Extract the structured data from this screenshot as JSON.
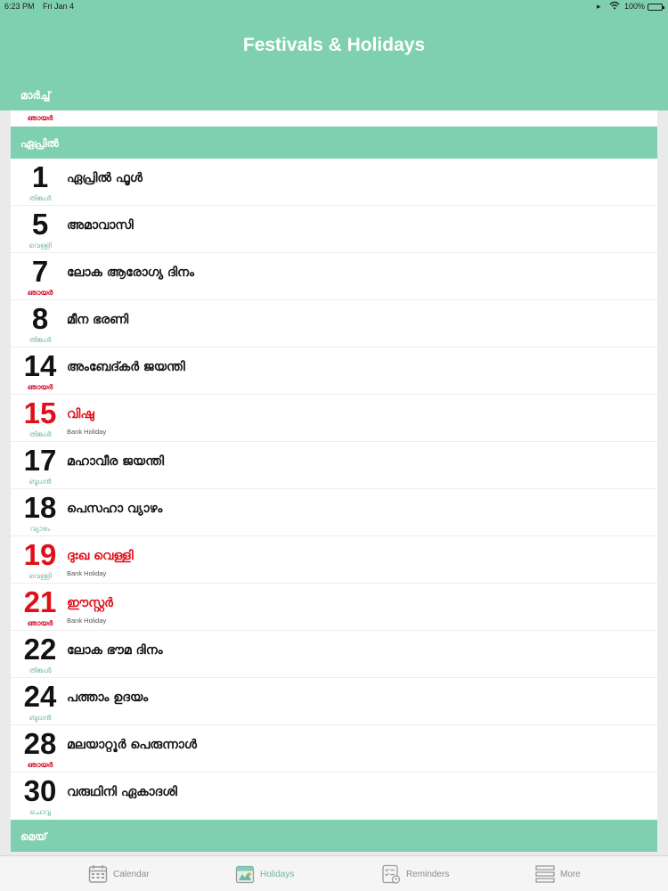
{
  "status_bar": {
    "time": "6:23 PM",
    "date": "Fri Jan 4",
    "battery": "100%"
  },
  "header": {
    "title": "Festivals & Holidays"
  },
  "colors": {
    "accent": "#7fcfb1",
    "holiday_red": "#e0101a",
    "weekday_green": "#6fb7a0"
  },
  "sticky_section": {
    "label": "മാർച്ച്",
    "trailing_weekday": "ഞായർ"
  },
  "april": {
    "label": "ഏപ്രിൽ",
    "rows": [
      {
        "day": "1",
        "weekday": "തിങ്കൾ",
        "title": "ഏപ്രിൽ ഫൂൾ",
        "sub": ""
      },
      {
        "day": "5",
        "weekday": "വെള്ളി",
        "title": "അമാവാസി",
        "sub": ""
      },
      {
        "day": "7",
        "weekday": "ഞായർ",
        "title": "ലോക ആരോഗ്യ ദിനം",
        "sub": ""
      },
      {
        "day": "8",
        "weekday": "തിങ്കൾ",
        "title": "മീന ഭരണി",
        "sub": ""
      },
      {
        "day": "14",
        "weekday": "ഞായർ",
        "title": "അംബേദ്കർ ജയന്തി",
        "sub": ""
      },
      {
        "day": "15",
        "weekday": "തിങ്കൾ",
        "title": "വിഷു",
        "sub": "Bank Holiday"
      },
      {
        "day": "17",
        "weekday": "ബുധൻ",
        "title": "മഹാവീര ജയന്തി",
        "sub": ""
      },
      {
        "day": "18",
        "weekday": "വ്യാഴം",
        "title": "പെസഹാ വ്യാഴം",
        "sub": ""
      },
      {
        "day": "19",
        "weekday": "വെള്ളി",
        "title": "ദുഃഖ വെള്ളി",
        "sub": "Bank Holiday"
      },
      {
        "day": "21",
        "weekday": "ഞായർ",
        "title": "ഈസ്റ്റർ",
        "sub": "Bank Holiday"
      },
      {
        "day": "22",
        "weekday": "തിങ്കൾ",
        "title": "ലോക ഭൗമ ദിനം",
        "sub": ""
      },
      {
        "day": "24",
        "weekday": "ബുധൻ",
        "title": "പത്താം ഉദയം",
        "sub": ""
      },
      {
        "day": "28",
        "weekday": "ഞായർ",
        "title": "മലയാറ്റൂർ പെരുന്നാൾ",
        "sub": ""
      },
      {
        "day": "30",
        "weekday": "ചൊവ്വ",
        "title": "വരുഥിനി ഏകാദശി",
        "sub": ""
      }
    ]
  },
  "next_section": {
    "label": "മെയ്"
  },
  "tabs": [
    {
      "label": "Calendar",
      "icon": "calendar-icon",
      "active": false
    },
    {
      "label": "Holidays",
      "icon": "holidays-icon",
      "active": true
    },
    {
      "label": "Reminders",
      "icon": "reminders-icon",
      "active": false
    },
    {
      "label": "More",
      "icon": "more-icon",
      "active": false
    }
  ]
}
